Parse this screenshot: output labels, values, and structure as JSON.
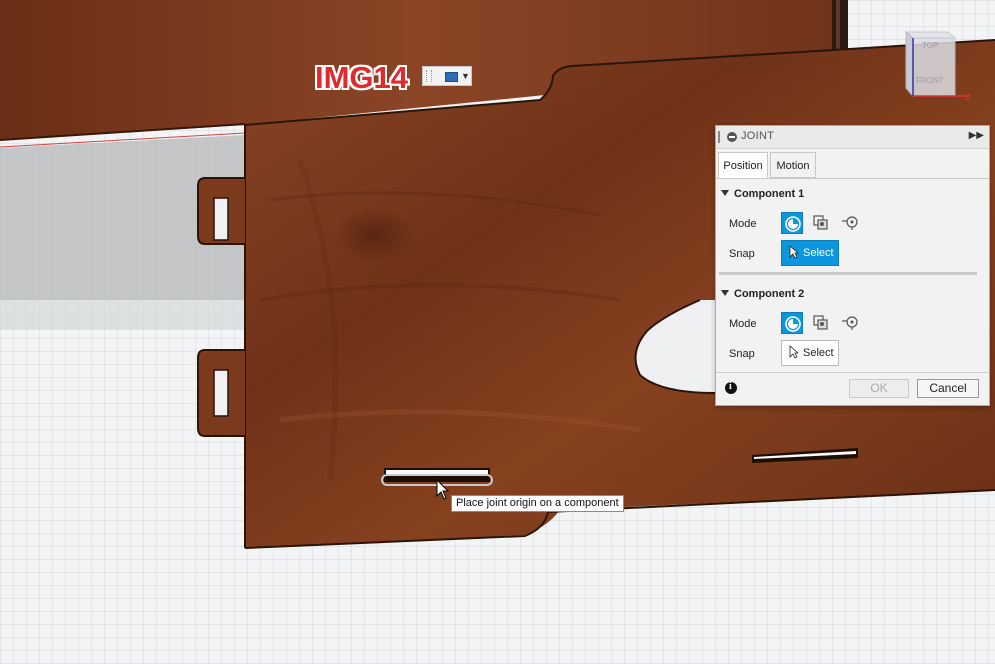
{
  "canvas_label": {
    "text": "IMG14"
  },
  "viewcube": {
    "top_label": "TOP",
    "front_label": "FRONT",
    "axis_label": "Z"
  },
  "tooltip": {
    "text": "Place joint origin on a component"
  },
  "joint_panel": {
    "title": "JOINT",
    "tabs": [
      {
        "label": "Position"
      },
      {
        "label": "Motion"
      }
    ],
    "component1": {
      "title": "Component 1",
      "mode_label": "Mode",
      "snap_label": "Snap",
      "select_label": "Select"
    },
    "component2": {
      "title": "Component 2",
      "mode_label": "Mode",
      "snap_label": "Snap",
      "select_label": "Select"
    },
    "ok_label": "OK",
    "cancel_label": "Cancel"
  },
  "colors": {
    "accent": "#0c96dd",
    "wood": "#7a3a1c",
    "label_red": "#e02a2e"
  }
}
